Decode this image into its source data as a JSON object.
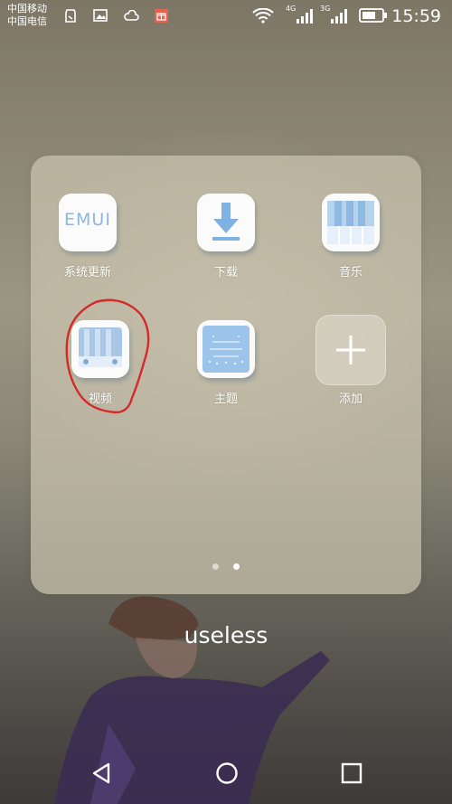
{
  "status_bar": {
    "carrier_1": "中国移动",
    "carrier_2": "中国电信",
    "network_1": "4G",
    "network_2": "3G",
    "time": "15:59",
    "icons": [
      "clean-icon",
      "image-icon",
      "cloud-icon",
      "gift-icon",
      "wifi-icon",
      "signal-icon",
      "signal-icon",
      "battery-icon"
    ]
  },
  "folder": {
    "apps": [
      {
        "label": "系统更新",
        "icon": "emui-icon",
        "logo_text": "EMUI"
      },
      {
        "label": "下载",
        "icon": "download-icon"
      },
      {
        "label": "音乐",
        "icon": "piano-icon"
      },
      {
        "label": "视频",
        "icon": "video-icon"
      },
      {
        "label": "主题",
        "icon": "theme-icon"
      },
      {
        "label": "添加",
        "icon": "plus-icon"
      }
    ],
    "name": "useless",
    "page_indicator": {
      "pages": 2,
      "current": 2
    }
  },
  "nav_bar": {
    "buttons": [
      "back-icon",
      "home-icon",
      "recents-icon"
    ]
  },
  "colors": {
    "text": "#ffffff",
    "icon_blue": "#b6d3ee",
    "annotation": "#d42a2a"
  }
}
